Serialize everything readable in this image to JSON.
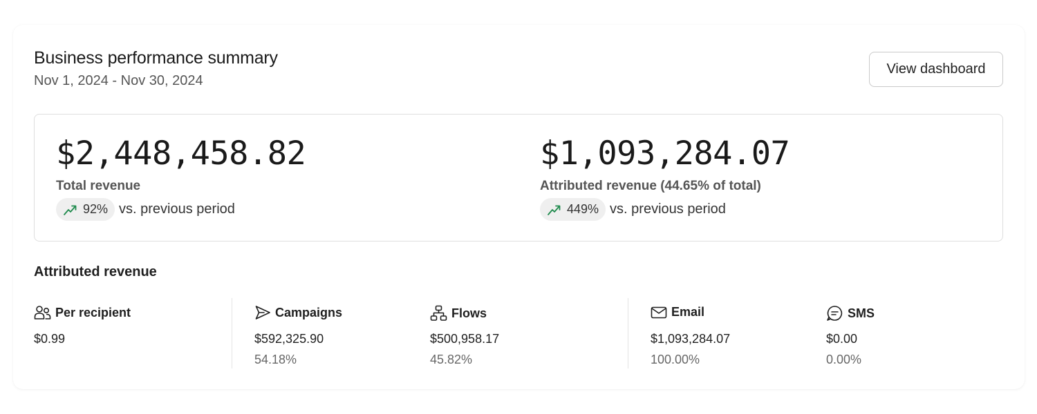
{
  "header": {
    "title": "Business performance summary",
    "date_range": "Nov 1, 2024 - Nov 30, 2024",
    "view_button_label": "View dashboard"
  },
  "summary": {
    "total": {
      "amount": "$2,448,458.82",
      "label": "Total revenue",
      "change": "92%",
      "comparison": "vs. previous period",
      "trend_icon": "trending-up-icon"
    },
    "attributed": {
      "amount": "$1,093,284.07",
      "label": "Attributed revenue (44.65% of total)",
      "change": "449%",
      "comparison": "vs. previous period",
      "trend_icon": "trending-up-icon"
    }
  },
  "attributed_section": {
    "title": "Attributed revenue",
    "columns": [
      {
        "icon": "people-icon",
        "label": "Per recipient",
        "value": "$0.99",
        "percent": ""
      },
      {
        "icon": "send-icon",
        "label": "Campaigns",
        "value": "$592,325.90",
        "percent": "54.18%"
      },
      {
        "icon": "flow-icon",
        "label": "Flows",
        "value": "$500,958.17",
        "percent": "45.82%"
      },
      {
        "icon": "mail-icon",
        "label": "Email",
        "value": "$1,093,284.07",
        "percent": "100.00%"
      },
      {
        "icon": "chat-icon",
        "label": "SMS",
        "value": "$0.00",
        "percent": "0.00%"
      }
    ]
  },
  "colors": {
    "trend_up": "#1e8a4c",
    "pill_bg": "#efefef",
    "border": "#dedede"
  }
}
